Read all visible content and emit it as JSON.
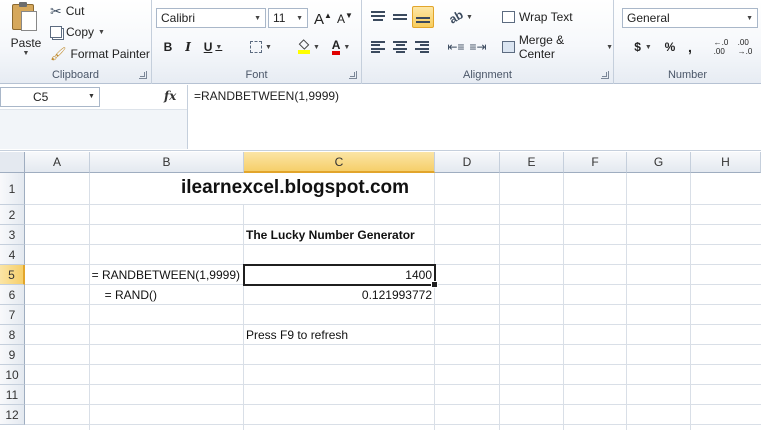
{
  "clipboard": {
    "paste_label": "Paste",
    "cut_label": "Cut",
    "copy_label": "Copy",
    "format_painter_label": "Format Painter",
    "group_label": "Clipboard"
  },
  "font": {
    "name": "Calibri",
    "size": "11",
    "grow_label": "A",
    "shrink_label": "A",
    "bold_label": "B",
    "italic_label": "I",
    "underline_label": "U",
    "font_color_label": "A",
    "group_label": "Font"
  },
  "alignment": {
    "wrap_text_label": "Wrap Text",
    "merge_center_label": "Merge & Center",
    "group_label": "Alignment"
  },
  "number": {
    "format": "General",
    "currency_label": "$",
    "percent_label": "%",
    "comma_label": ",",
    "increase_decimal_label": "←.0\n.00",
    "decrease_decimal_label": ".00\n→.0",
    "group_label": "Number"
  },
  "formula_bar": {
    "name_box": "C5",
    "fx_label": "fx",
    "formula": "=RANDBETWEEN(1,9999)"
  },
  "columns": [
    "A",
    "B",
    "C",
    "D",
    "E",
    "F",
    "G",
    "H"
  ],
  "rows": [
    "1",
    "2",
    "3",
    "4",
    "5",
    "6",
    "7",
    "8",
    "9",
    "10",
    "11",
    "12"
  ],
  "cells": {
    "title": "ilearnexcel.blogspot.com",
    "heading": "The Lucky Number Generator",
    "label_randbetween": "= RANDBETWEEN(1,9999)",
    "value_randbetween": "1400",
    "label_rand": "= RAND()",
    "value_rand": "0.121993772",
    "note": "Press F9 to refresh"
  },
  "colors": {
    "selected_header": "#f6cf6a",
    "selection_border": "#1f1f1f",
    "ribbon_border": "#b6c2d3"
  }
}
